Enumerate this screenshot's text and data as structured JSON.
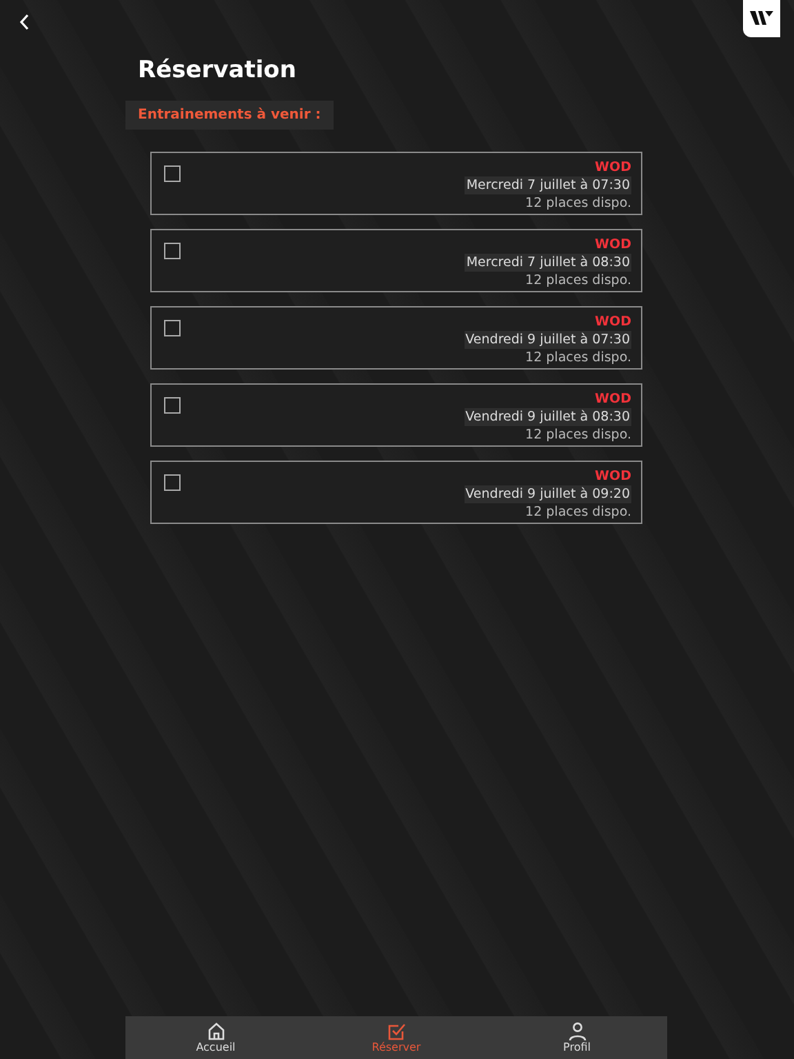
{
  "header": {
    "title": "Réservation"
  },
  "section": {
    "label": "Entrainements à venir :"
  },
  "sessions": [
    {
      "checked": false,
      "type": "WOD",
      "date": "Mercredi 7 juillet à 07:30",
      "places": "12 places dispo."
    },
    {
      "checked": false,
      "type": "WOD",
      "date": "Mercredi 7 juillet à 08:30",
      "places": "12 places dispo."
    },
    {
      "checked": false,
      "type": "WOD",
      "date": "Vendredi 9 juillet à 07:30",
      "places": "12 places dispo."
    },
    {
      "checked": false,
      "type": "WOD",
      "date": "Vendredi 9 juillet à 08:30",
      "places": "12 places dispo."
    },
    {
      "checked": false,
      "type": "WOD",
      "date": "Vendredi 9 juillet à 09:20",
      "places": "12 places dispo."
    }
  ],
  "nav": [
    {
      "kind": "home",
      "label": "Accueil",
      "selected": false
    },
    {
      "kind": "book",
      "label": "Réserver",
      "selected": true
    },
    {
      "kind": "profile",
      "label": "Profil",
      "selected": false
    }
  ]
}
